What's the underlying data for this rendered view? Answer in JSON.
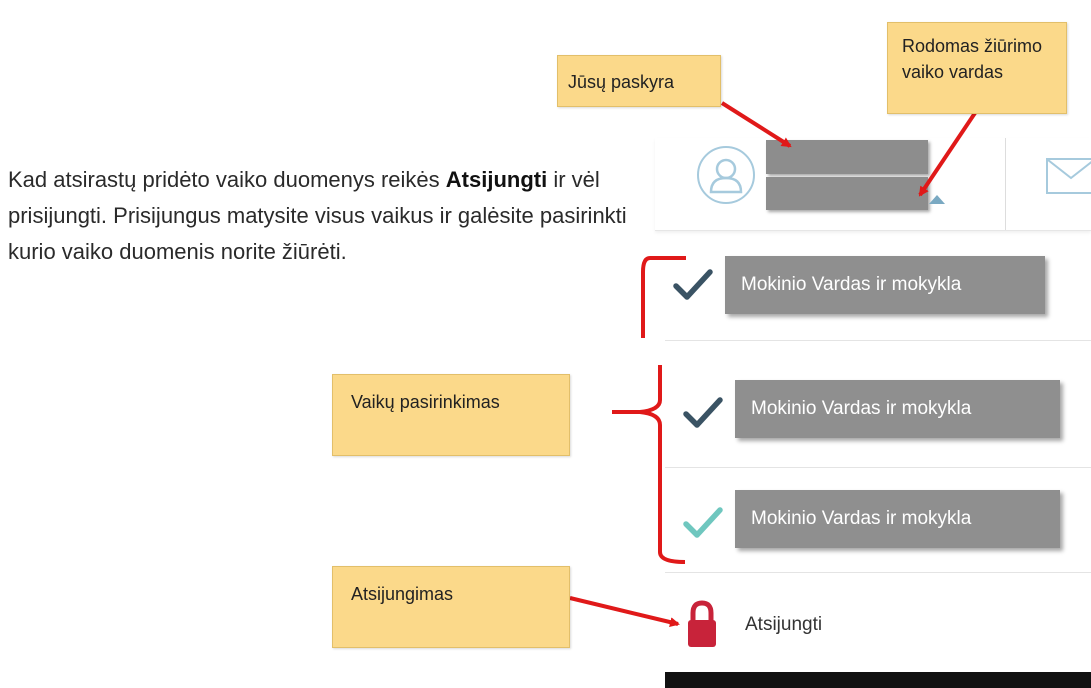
{
  "instruction": {
    "before": "Kad atsirastų pridėto vaiko duomenys reikės ",
    "bold": "Atsijungti",
    "after": " ir vėl prisijungti. Prisijungus matysite visus vaikus ir galėsite pasirinkti kurio vaiko duomenis norite žiūrėti."
  },
  "callouts": {
    "account": "Jūsų paskyra",
    "child_name": "Rodomas žiūrimo vaiko vardas",
    "children_select": "Vaikų pasirinkimas",
    "logout": "Atsijungimas"
  },
  "students": [
    {
      "label": "Mokinio  Vardas ir mokykla",
      "check_color": "#3a5364"
    },
    {
      "label": "Mokinio  Vardas ir mokykla",
      "check_color": "#3a5364"
    },
    {
      "label": "Mokinio  Vardas ir mokykla",
      "check_color": "#6fc7bf"
    }
  ],
  "logout": {
    "label": "Atsijungti",
    "lock_color": "#c8233a"
  },
  "colors": {
    "callout_bg": "#fbd98a",
    "arrow": "#e01919",
    "icon_outline": "#a6cadd"
  },
  "icons": {
    "avatar": "user-icon",
    "mail": "mail-icon",
    "caret": "caret-up-icon",
    "check": "check-icon",
    "lock": "lock-icon"
  }
}
